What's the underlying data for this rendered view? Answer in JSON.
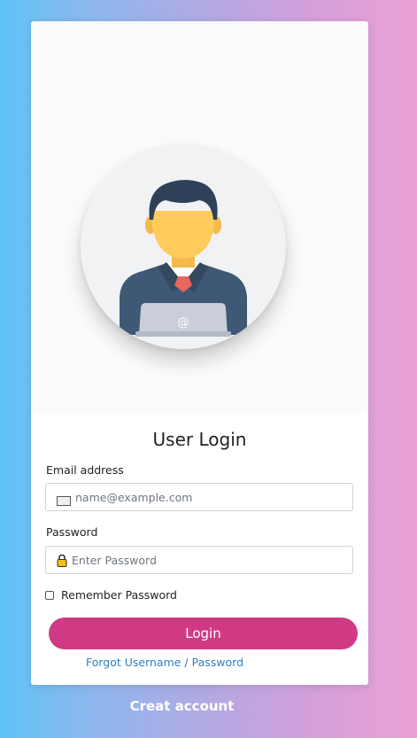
{
  "login_card": {
    "title": "User Login",
    "email": {
      "label": "Email address",
      "placeholder": "name@example.com",
      "value": "",
      "icon": "envelope-icon"
    },
    "password": {
      "label": "Password",
      "placeholder": "Enter Password",
      "value": "",
      "icon": "lock-icon"
    },
    "remember": {
      "label": "Remember Password",
      "checked": false
    },
    "login_button": "Login",
    "forgot_link": "Forgot Username / Password"
  },
  "create_account_link": "Creat account",
  "colors": {
    "button": "#d03a85",
    "link": "#2f7fc1",
    "gradient_left": "#5ec3f6",
    "gradient_right": "#eaa1d4"
  },
  "hero": {
    "avatar_icon": "user-with-laptop-icon"
  }
}
